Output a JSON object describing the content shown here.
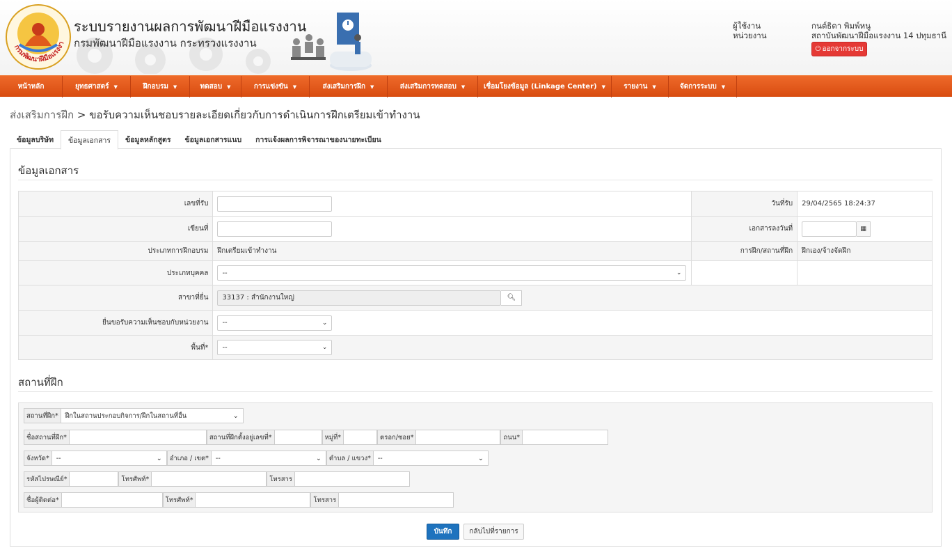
{
  "header": {
    "title": "ระบบรายงานผลการพัฒนาฝีมือแรงงาน",
    "subtitle": "กรมพัฒนาฝีมือแรงงาน กระทรวงแรงงาน",
    "logo_text": "กรมพัฒนาฝีมือแรงงาน",
    "user_label": "ผู้ใช้งาน",
    "unit_label": "หน่วยงาน",
    "user_name": "กนต์ธิดา พิมพ์หนู",
    "unit_name": "สถาบันพัฒนาฝีมือแรงงาน 14 ปทุมธานี",
    "logout_label": "ออกจากระบบ"
  },
  "nav": [
    {
      "label": "หน้าหลัก",
      "dropdown": false
    },
    {
      "label": "ยุทธศาสตร์",
      "dropdown": true
    },
    {
      "label": "ฝึกอบรม",
      "dropdown": true
    },
    {
      "label": "ทดสอบ",
      "dropdown": true
    },
    {
      "label": "การแข่งขัน",
      "dropdown": true
    },
    {
      "label": "ส่งเสริมการฝึก",
      "dropdown": true
    },
    {
      "label": "ส่งเสริมการทดสอบ",
      "dropdown": true
    },
    {
      "label": "เชื่อมโยงข้อมูล (Linkage Center)",
      "dropdown": true
    },
    {
      "label": "รายงาน",
      "dropdown": true
    },
    {
      "label": "จัดการระบบ",
      "dropdown": true
    }
  ],
  "breadcrumb": {
    "parent": "ส่งเสริมการฝึก",
    "separator": " > ",
    "current": "ขอรับความเห็นชอบรายละเอียดเกี่ยวกับการดำเนินการฝึกเตรียมเข้าทำงาน"
  },
  "tabs": [
    {
      "label": "ข้อมูลบริษัท",
      "active": false
    },
    {
      "label": "ข้อมูลเอกสาร",
      "active": true
    },
    {
      "label": "ข้อมูลหลักสูตร",
      "active": false
    },
    {
      "label": "ข้อมูลเอกสารแนบ",
      "active": false
    },
    {
      "label": "การแจ้งผลการพิจารณาของนายทะเบียน",
      "active": false
    }
  ],
  "doc_section": {
    "title": "ข้อมูลเอกสาร",
    "receipt_no_label": "เลขที่รับ",
    "receipt_no_value": "",
    "receipt_date_label": "วันที่รับ",
    "receipt_date_value": "29/04/2565 18:24:37",
    "written_at_label": "เขียนที่",
    "written_at_value": "",
    "doc_date_label": "เอกสารลงวันที่",
    "doc_date_value": "",
    "training_type_label": "ประเภทการฝึกอบรม",
    "training_type_value": "ฝึกเตรียมเข้าทำงาน",
    "training_place_label": "การฝึก/สถานที่ฝึก",
    "training_place_value": "ฝึกเอง/จ้างจัดฝึก",
    "person_type_label": "ประเภทบุคคล",
    "person_type_value": "--",
    "branch_label": "สาขาที่ยื่น",
    "branch_value": "33137 : สำนักงานใหญ่",
    "approval_unit_label": "ยื่นขอรับความเห็นชอบกับหน่วยงาน",
    "approval_unit_value": "--",
    "area_label": "พื้นที่*",
    "area_value": "--"
  },
  "place_section": {
    "title": "สถานที่ฝึก",
    "place_label": "สถานที่ฝึก*",
    "place_value": "ฝึกในสถานประกอบกิจการ/ฝึกในสถานที่อื่น",
    "place_name_label": "ชื่อสถานที่ฝึก*",
    "address_label": "สถานที่ฝึกตั้งอยู่เลขที่*",
    "moo_label": "หมู่ที่*",
    "soi_label": "ตรอก/ซอย*",
    "road_label": "ถนน*",
    "province_label": "จังหวัด*",
    "province_value": "--",
    "district_label": "อำเภอ / เขต*",
    "district_value": "--",
    "subdistrict_label": "ตำบล / แขวง*",
    "subdistrict_value": "--",
    "postcode_label": "รหัสไปรษณีย์*",
    "phone_label": "โทรศัพท์*",
    "fax_label": "โทรสาร",
    "contact_label": "ชื่อผู้ติดต่อ*",
    "contact_phone_label": "โทรศัพท์*",
    "contact_fax_label": "โทรสาร"
  },
  "actions": {
    "save_label": "บันทึก",
    "back_label": "กลับไปที่รายการ"
  },
  "colors": {
    "nav_orange": "#e05a1c",
    "save_blue": "#1e73be",
    "logout_red": "#e53935"
  }
}
